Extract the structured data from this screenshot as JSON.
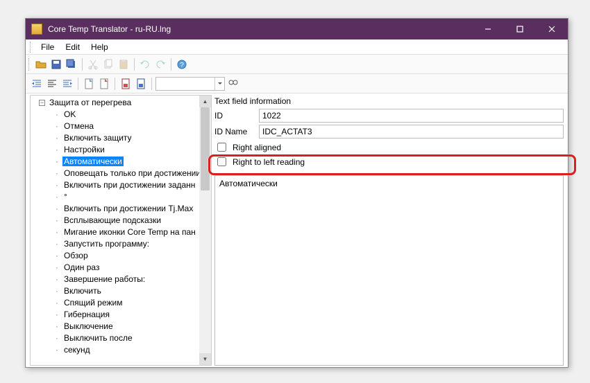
{
  "window": {
    "title": "Core Temp Translator - ru-RU.lng"
  },
  "menu": {
    "file": "File",
    "edit": "Edit",
    "help": "Help"
  },
  "tree": {
    "root": "Защита от перегрева",
    "items": [
      "OK",
      "Отмена",
      "Включить защиту",
      "Настройки",
      "Автоматически",
      "Оповещать только при достижении",
      "Включить при достижении заданн",
      "°",
      "Включить при достижении Tj.Max",
      "Всплывающие подсказки",
      "Мигание иконки Core Temp на пан",
      "Запустить программу:",
      "Обзор",
      "Один раз",
      "Завершение работы:",
      "Включить",
      "Спящий режим",
      "Гибернация",
      "Выключение",
      "Выключить после",
      "секунд"
    ],
    "selectedIndex": 4
  },
  "info": {
    "title": "Text field information",
    "idLabel": "ID",
    "idValue": "1022",
    "idNameLabel": "ID Name",
    "idNameValue": "IDC_ACTAT3",
    "rightAligned": "Right aligned",
    "rtl": "Right to left reading"
  },
  "editor": {
    "value": "Автоматически"
  }
}
